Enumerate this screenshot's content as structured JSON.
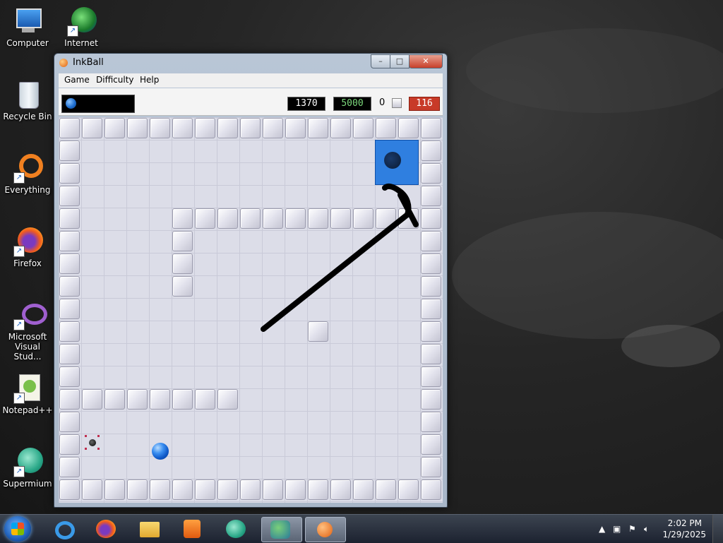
{
  "desktop": {
    "icons": [
      {
        "label": "Computer",
        "icon": "computer-icon"
      },
      {
        "label": "Internet",
        "icon": "internet-icon"
      },
      {
        "label": "Recycle Bin",
        "icon": "recycle-bin-icon"
      },
      {
        "label": "Everything",
        "icon": "everything-icon"
      },
      {
        "label": "Firefox",
        "icon": "firefox-icon"
      },
      {
        "label": "Microsoft Visual Stud...",
        "icon": "visual-studio-icon"
      },
      {
        "label": "Notepad++",
        "icon": "notepad-plus-plus-icon"
      },
      {
        "label": "Supermium",
        "icon": "supermium-icon"
      }
    ]
  },
  "window": {
    "title": "InkBall",
    "buttons": {
      "minimize": "–",
      "maximize": "□",
      "close": "✕"
    }
  },
  "menu": {
    "items": [
      "Game",
      "Difficulty",
      "Help"
    ]
  },
  "status": {
    "score": "1370",
    "goal": "5000",
    "count": "0",
    "timer": "116",
    "colors": {
      "score_bg": "#000000",
      "goal_text": "#7cd87c",
      "timer_bg": "#c83a28"
    }
  },
  "board": {
    "cols": 17,
    "rows": 17,
    "walls": [
      [
        0,
        0
      ],
      [
        1,
        0
      ],
      [
        2,
        0
      ],
      [
        3,
        0
      ],
      [
        4,
        0
      ],
      [
        5,
        0
      ],
      [
        6,
        0
      ],
      [
        7,
        0
      ],
      [
        8,
        0
      ],
      [
        9,
        0
      ],
      [
        10,
        0
      ],
      [
        11,
        0
      ],
      [
        12,
        0
      ],
      [
        13,
        0
      ],
      [
        14,
        0
      ],
      [
        15,
        0
      ],
      [
        16,
        0
      ],
      [
        0,
        16
      ],
      [
        1,
        16
      ],
      [
        2,
        16
      ],
      [
        3,
        16
      ],
      [
        4,
        16
      ],
      [
        5,
        16
      ],
      [
        6,
        16
      ],
      [
        7,
        16
      ],
      [
        8,
        16
      ],
      [
        9,
        16
      ],
      [
        10,
        16
      ],
      [
        11,
        16
      ],
      [
        12,
        16
      ],
      [
        13,
        16
      ],
      [
        14,
        16
      ],
      [
        15,
        16
      ],
      [
        16,
        16
      ],
      [
        0,
        1
      ],
      [
        0,
        2
      ],
      [
        0,
        3
      ],
      [
        0,
        4
      ],
      [
        0,
        5
      ],
      [
        0,
        6
      ],
      [
        0,
        7
      ],
      [
        0,
        8
      ],
      [
        0,
        9
      ],
      [
        0,
        10
      ],
      [
        0,
        11
      ],
      [
        0,
        12
      ],
      [
        0,
        13
      ],
      [
        0,
        14
      ],
      [
        0,
        15
      ],
      [
        16,
        1
      ],
      [
        16,
        2
      ],
      [
        16,
        3
      ],
      [
        16,
        4
      ],
      [
        16,
        5
      ],
      [
        16,
        6
      ],
      [
        16,
        7
      ],
      [
        16,
        8
      ],
      [
        16,
        9
      ],
      [
        16,
        10
      ],
      [
        16,
        11
      ],
      [
        16,
        12
      ],
      [
        16,
        13
      ],
      [
        16,
        14
      ],
      [
        16,
        15
      ],
      [
        5,
        4
      ],
      [
        6,
        4
      ],
      [
        7,
        4
      ],
      [
        8,
        4
      ],
      [
        9,
        4
      ],
      [
        10,
        4
      ],
      [
        11,
        4
      ],
      [
        12,
        4
      ],
      [
        13,
        4
      ],
      [
        14,
        4
      ],
      [
        15,
        4
      ],
      [
        5,
        5
      ],
      [
        5,
        6
      ],
      [
        5,
        7
      ],
      [
        11,
        9
      ],
      [
        1,
        12
      ],
      [
        2,
        12
      ],
      [
        3,
        12
      ],
      [
        4,
        12
      ],
      [
        5,
        12
      ],
      [
        6,
        12
      ],
      [
        7,
        12
      ]
    ],
    "goal": {
      "col": 14,
      "row": 1,
      "color": "#2f7fe0"
    },
    "start_hole": {
      "col": 1,
      "row": 14
    },
    "balls": [
      {
        "col": 4,
        "row": 14.6,
        "color": "blue"
      }
    ],
    "next_ball_color": "blue",
    "ink_stroke_color": "#000000"
  },
  "taskbar": {
    "apps": [
      "start-orb",
      "internet-explorer-icon",
      "firefox-icon",
      "file-explorer-icon",
      "media-player-icon",
      "supermium-icon",
      "network-people-icon",
      "inkball-icon"
    ],
    "clock_time": "2:02 PM",
    "clock_date": "1/29/2025"
  }
}
